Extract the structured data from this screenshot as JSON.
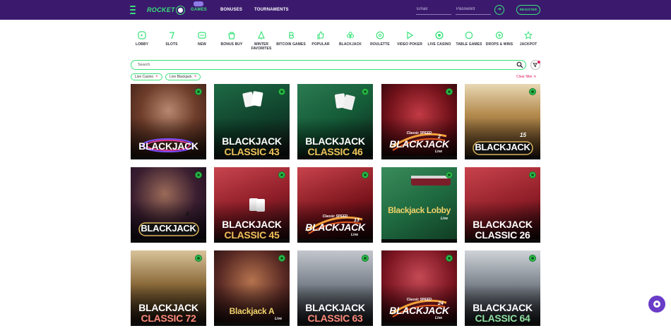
{
  "header": {
    "logo": "ROCKET",
    "nav": {
      "games": "GAMES",
      "bonuses": "BONUSES",
      "tournaments": "TOURNAMENTS"
    },
    "email_placeholder": "Email",
    "password_placeholder": "Password",
    "register": "REGISTER"
  },
  "categories": [
    {
      "label": "LOBBY",
      "icon": "gamepad-icon"
    },
    {
      "label": "SLOTS",
      "icon": "slot-icon"
    },
    {
      "label": "NEW",
      "icon": "new-badge-icon"
    },
    {
      "label": "BONUS BUY",
      "icon": "bonus-buy-icon"
    },
    {
      "label": "WINTER FAVORITES",
      "icon": "tree-icon"
    },
    {
      "label": "BITCOIN GAMES",
      "icon": "bitcoin-icon"
    },
    {
      "label": "POPULAR",
      "icon": "thumb-up-icon"
    },
    {
      "label": "BLACKJACK",
      "icon": "club-icon"
    },
    {
      "label": "ROULETTE",
      "icon": "roulette-icon"
    },
    {
      "label": "VIDEO POKER",
      "icon": "play-icon"
    },
    {
      "label": "LIVE CASINO",
      "icon": "chip-icon"
    },
    {
      "label": "TABLE GAMES",
      "icon": "table-icon"
    },
    {
      "label": "DROPS & WINS",
      "icon": "drops-icon"
    },
    {
      "label": "JACKPOT",
      "icon": "jackpot-icon"
    }
  ],
  "search": {
    "placeholder": "Search"
  },
  "filters": {
    "chips": [
      "Live Casino",
      "Live Blackjack"
    ],
    "clear": "Clear filter"
  },
  "colors": {
    "brand": "#39e27a",
    "header": "#3b1a6e",
    "accent": "#e0245e"
  },
  "games": [
    {
      "line1": "BLACKJACK",
      "line2": ""
    },
    {
      "line1": "BLACKJACK",
      "line2": "CLASSIC 43"
    },
    {
      "line1": "BLACKJACK",
      "line2": "CLASSIC 46"
    },
    {
      "line1": "BLACKJACK",
      "line2": "",
      "speed_top": "Classic SPEED",
      "number": "2",
      "tag": "Live"
    },
    {
      "line1": "BLACKJACK",
      "line2": "",
      "number": "15"
    },
    {
      "line1": "BLACKJACK",
      "line2": "",
      "number": "4"
    },
    {
      "line1": "BLACKJACK",
      "line2": "CLASSIC 45"
    },
    {
      "line1": "BLACKJACK",
      "line2": "",
      "speed_top": "Classic SPEED",
      "number": "13",
      "tag": "Live"
    },
    {
      "line1": "Blackjack Lobby",
      "line2": "",
      "tag": "Live"
    },
    {
      "line1": "BLACKJACK",
      "line2": "CLASSIC 26"
    },
    {
      "line1": "BLACKJACK",
      "line2": "CLASSIC 72"
    },
    {
      "line1": "Blackjack A",
      "line2": "",
      "tag": "Live"
    },
    {
      "line1": "BLACKJACK",
      "line2": "CLASSIC 63"
    },
    {
      "line1": "BLACKJACK",
      "line2": "",
      "speed_top": "Classic SPEED",
      "number": "24",
      "tag": "Live"
    },
    {
      "line1": "BLACKJACK",
      "line2": "CLASSIC 64"
    }
  ]
}
